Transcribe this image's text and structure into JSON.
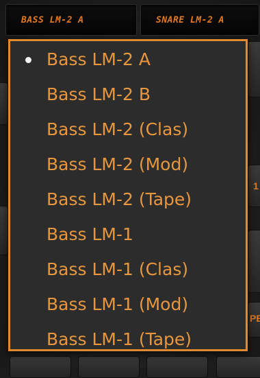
{
  "top_slots": {
    "bass_label": "BASS LM-2 A",
    "snare_label": "SNARE LM-2 A"
  },
  "side_text": {
    "right_mid": "1",
    "right_lower": "PE"
  },
  "menu": {
    "selected_index": 0,
    "items": [
      "Bass LM-2 A",
      "Bass LM-2 B",
      "Bass LM-2 (Clas)",
      "Bass LM-2 (Mod)",
      "Bass LM-2 (Tape)",
      "Bass LM-1",
      "Bass LM-1 (Clas)",
      "Bass LM-1 (Mod)",
      "Bass LM-1 (Tape)"
    ]
  },
  "icons": {
    "selected_marker": "bullet-icon"
  },
  "colors": {
    "accent": "#e8973e",
    "menu_border": "#e08a32",
    "menu_bg": "#2c2c2c",
    "selected_bullet": "#f4f4f4"
  }
}
